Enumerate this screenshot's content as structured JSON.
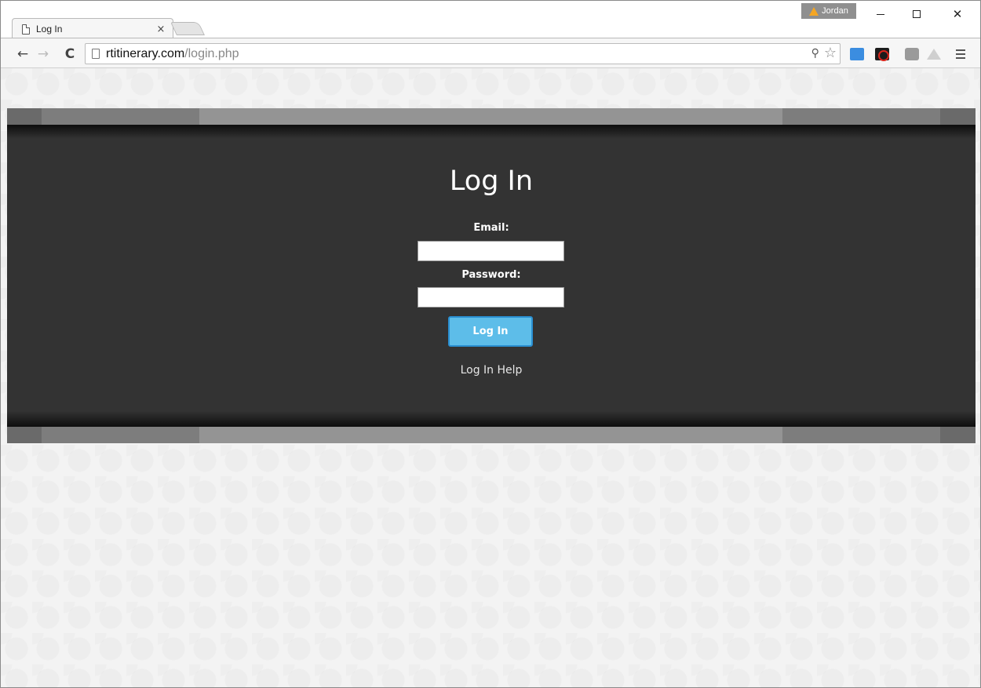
{
  "browser": {
    "tab": {
      "title": "Log In",
      "close_glyph": "×",
      "icon": "page-icon"
    },
    "profile": {
      "name": "Jordan",
      "icon": "warning-icon",
      "badge_color": "#8f8f8f"
    },
    "window_controls": {
      "close_glyph": "✕"
    },
    "toolbar": {
      "back_glyph": "←",
      "forward_glyph": "→",
      "reload_glyph": "C",
      "url_host": "rtitinerary.com",
      "url_path": "/login.php",
      "star_glyph": "☆",
      "key_glyph": "⚲"
    }
  },
  "login": {
    "title": "Log In",
    "email_label": "Email:",
    "email_value": "",
    "password_label": "Password:",
    "password_value": "",
    "submit_label": "Log In",
    "help_link": "Log In Help"
  },
  "colors": {
    "panel_bg": "#333333",
    "stripe_light": "#949494",
    "stripe_dark": "#6a6a6a",
    "button_bg": "#5dbde9",
    "button_border": "#2a8fd1"
  }
}
